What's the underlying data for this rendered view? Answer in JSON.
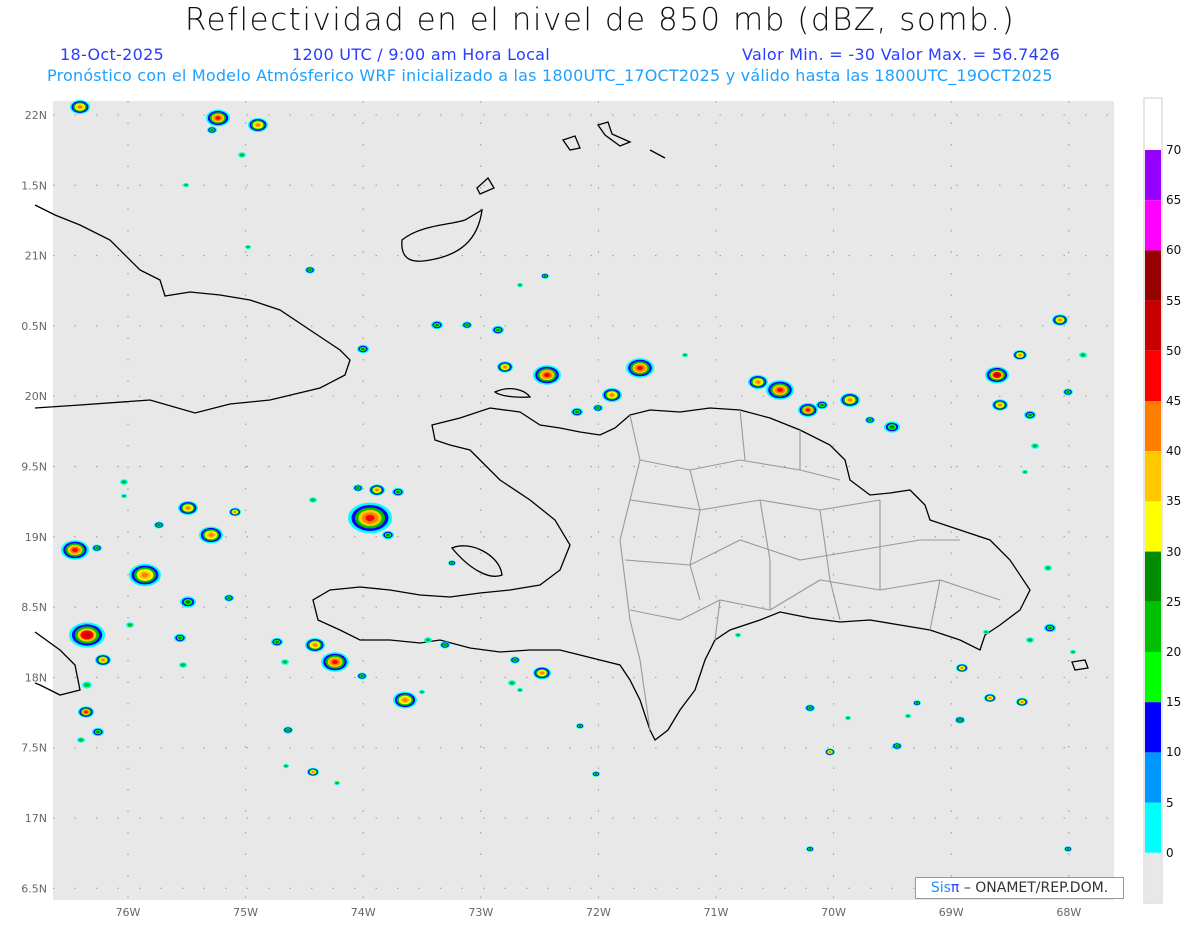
{
  "header": {
    "title": "Reflectividad en el nivel de 850 mb (dBZ, somb.)",
    "date": "18-Oct-2025",
    "time": "1200 UTC / 9:00 am Hora Local",
    "min_max": "Valor Min. = -30  Valor Max. = 56.7426",
    "forecast_info": "Pronóstico con el Modelo Atmósferico WRF inicializado a las 1800UTC_17OCT2025 y válido hasta las  1800UTC_19OCT2025"
  },
  "axes": {
    "lon_labels": [
      "76W",
      "75W",
      "74W",
      "73W",
      "72W",
      "71W",
      "70W",
      "69W",
      "68W"
    ],
    "lat_labels": [
      "22N",
      "1.5N",
      "21N",
      "0.5N",
      "20N",
      "9.5N",
      "19N",
      "8.5N",
      "18N",
      "7.5N",
      "17N",
      "6.5N"
    ]
  },
  "colorbar": {
    "unit": "dBZ",
    "labels": [
      "70",
      "65",
      "60",
      "55",
      "50",
      "45",
      "40",
      "35",
      "30",
      "25",
      "20",
      "15",
      "10",
      "5",
      "0"
    ],
    "colors": [
      "#9600ff",
      "#ff00ff",
      "#960000",
      "#c80000",
      "#ff0000",
      "#ff7d00",
      "#ffc800",
      "#ffff00",
      "#008c00",
      "#00c000",
      "#00ff00",
      "#0000ff",
      "#0096ff",
      "#00ffff"
    ]
  },
  "credit": {
    "sis": "Sis",
    "pi": "π",
    "rest": "– ONAMET/REP.DOM."
  }
}
